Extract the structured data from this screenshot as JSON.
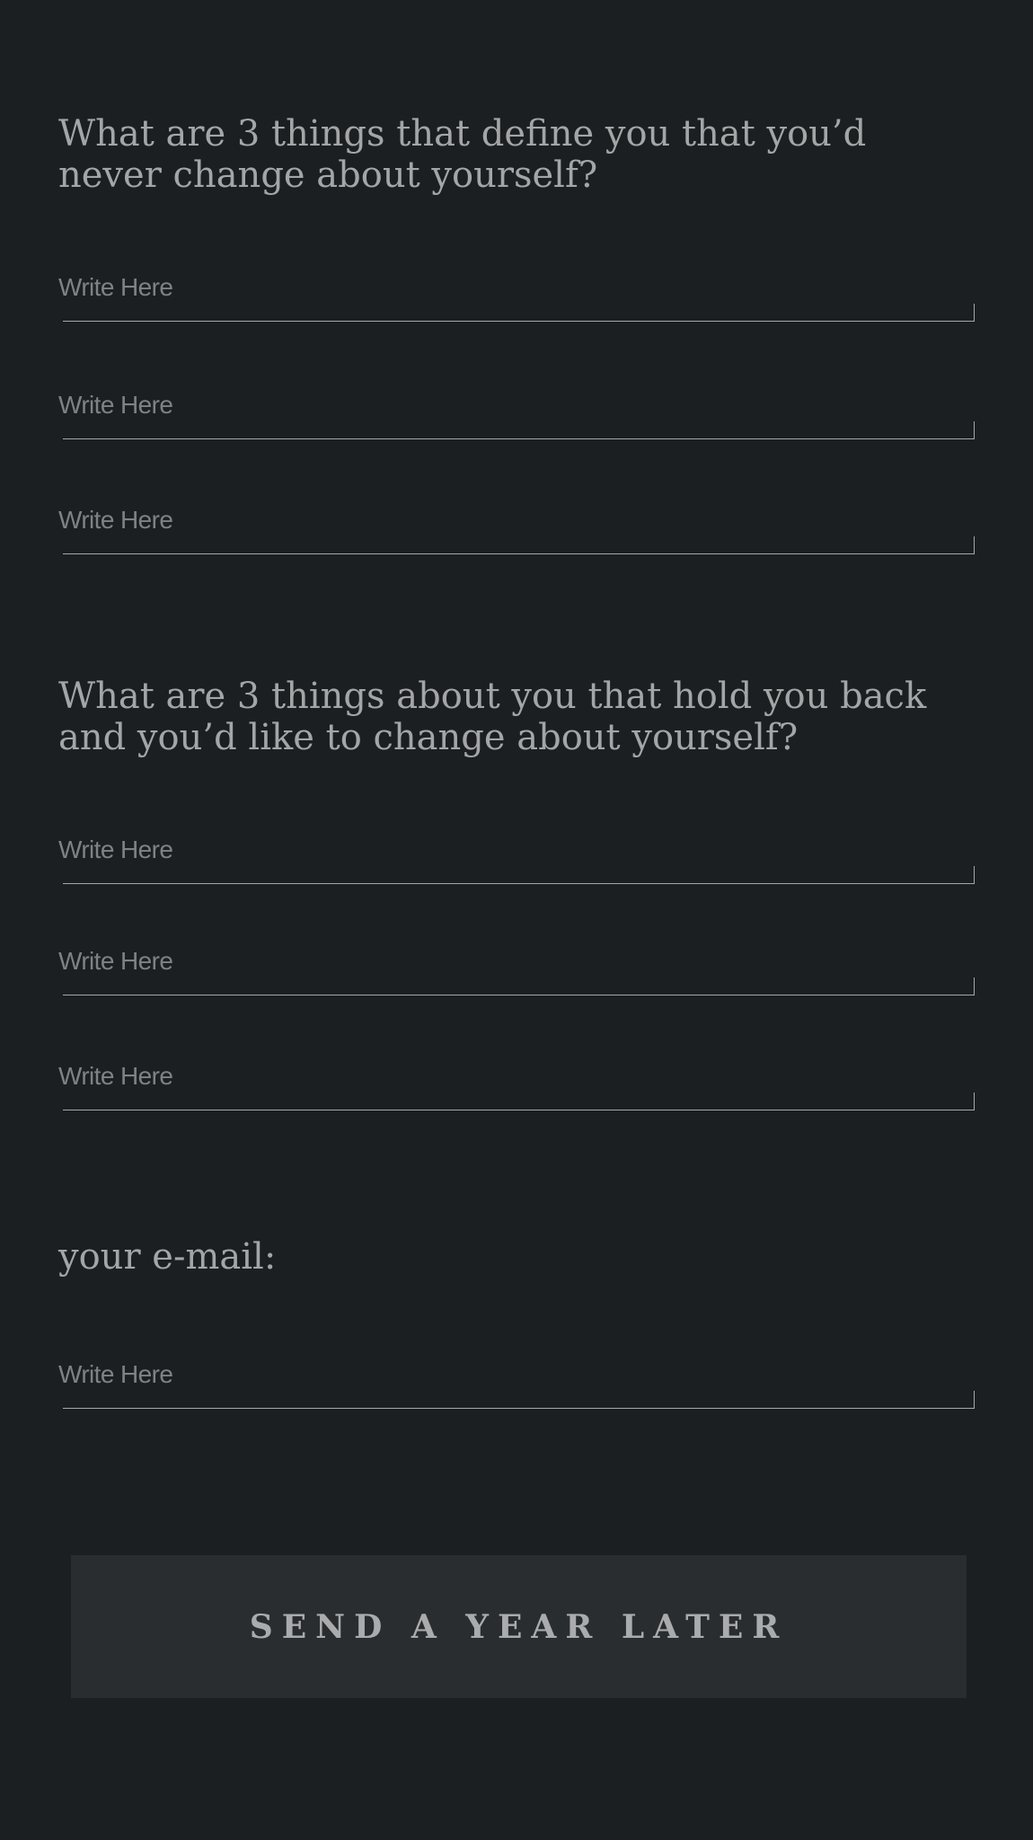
{
  "sections": [
    {
      "question": "What are 3 things that define you that you’d never change about yourself?",
      "fields": [
        {
          "value": "",
          "placeholder": "Write Here"
        },
        {
          "value": "",
          "placeholder": "Write Here"
        },
        {
          "value": "",
          "placeholder": "Write Here"
        }
      ]
    },
    {
      "question": "What are 3 things about you that hold you back and you’d like to change about yourself?",
      "fields": [
        {
          "value": "",
          "placeholder": "Write Here"
        },
        {
          "value": "",
          "placeholder": "Write Here"
        },
        {
          "value": "",
          "placeholder": "Write Here"
        }
      ]
    }
  ],
  "email": {
    "label": "your e-mail:",
    "value": "",
    "placeholder": "Write Here"
  },
  "submit": {
    "label": "SEND A YEAR LATER"
  }
}
